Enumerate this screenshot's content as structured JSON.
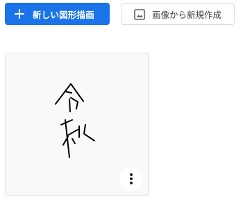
{
  "toolbar": {
    "new_drawing_label": "新しい図形描画",
    "new_drawing_icon": "plus-icon",
    "from_image_label": "画像から新規作成",
    "from_image_icon": "image-icon"
  },
  "drawings": [
    {
      "thumbnail": "handwritten-reiwa-signature",
      "more_icon": "more-vert-icon"
    }
  ],
  "colors": {
    "primary": "#1a73e8",
    "primary_text": "#ffffff",
    "outline_border": "#dadce0",
    "text": "#3c4043",
    "card_background": "#f9f9f9",
    "ink": "#000000"
  }
}
